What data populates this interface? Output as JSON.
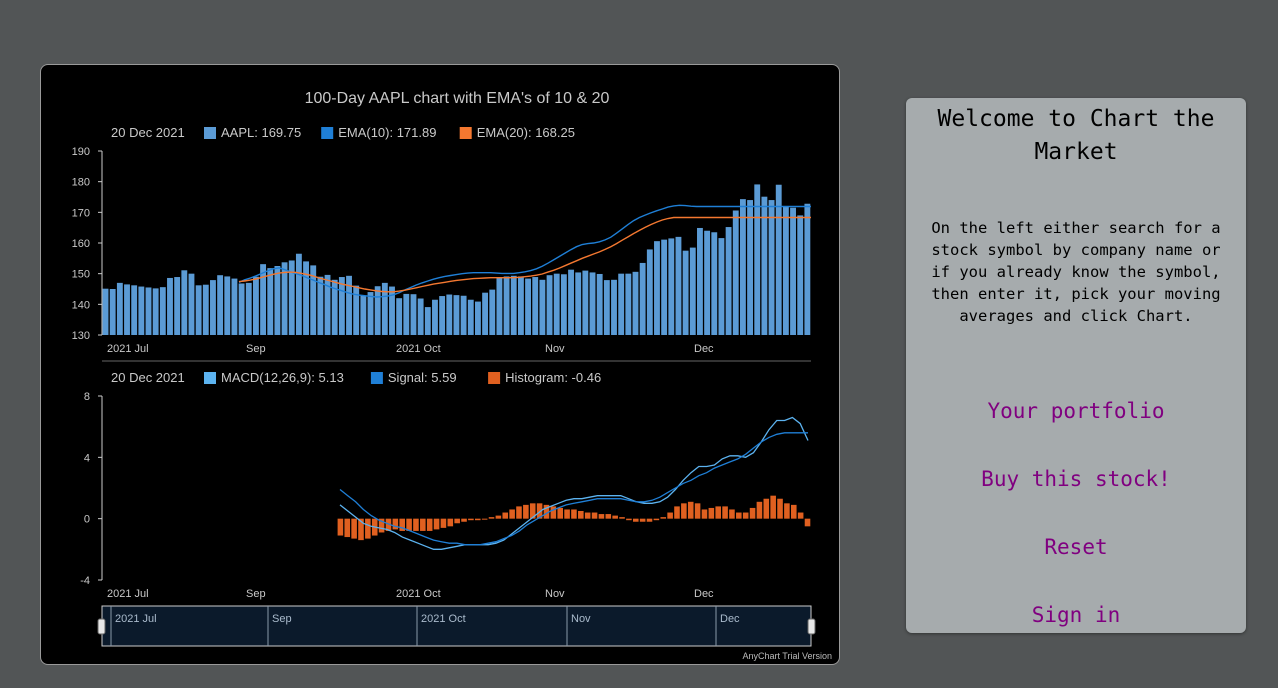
{
  "welcome": {
    "title": "Welcome to Chart the Market",
    "text": "On the left either search for a stock symbol by company name or if you already know the symbol, then enter it, pick your moving averages and click Chart.",
    "links": [
      "Your portfolio",
      "Buy this stock!",
      "Reset",
      "Sign in"
    ]
  },
  "chart_data": [
    {
      "type": "bar",
      "title": "100-Day AAPL chart with EMA's of 10 & 20",
      "legend": {
        "date": "20 Dec 2021",
        "items": [
          {
            "label": "AAPL: 169.75",
            "color": "#5b9bd5"
          },
          {
            "label": "EMA(10): 171.89",
            "color": "#1f7fd6"
          },
          {
            "label": "EMA(20): 168.25",
            "color": "#f47830"
          }
        ]
      },
      "ylim": [
        130,
        190
      ],
      "yticks": [
        "130",
        "140",
        "150",
        "160",
        "170",
        "180",
        "190"
      ],
      "xticks": [
        "2021 Jul",
        "Sep",
        "2021 Oct",
        "Nov",
        "Dec"
      ],
      "series": [
        {
          "name": "AAPL",
          "type": "bar",
          "color": "#5b9bd5",
          "values": [
            145.1,
            145.0,
            147.0,
            146.5,
            146.2,
            145.8,
            145.5,
            145.2,
            145.6,
            148.6,
            148.9,
            151.1,
            150.0,
            146.2,
            146.4,
            147.9,
            149.5,
            149.1,
            148.4,
            146.8,
            147.0,
            149.0,
            153.1,
            151.8,
            152.5,
            153.7,
            154.3,
            156.5,
            154.0,
            152.7,
            149.0,
            149.6,
            148.0,
            148.9,
            149.3,
            146.1,
            142.9,
            144.0,
            145.9,
            147.0,
            145.8,
            142.0,
            143.4,
            143.3,
            141.9,
            139.1,
            141.5,
            142.7,
            143.2,
            143.0,
            142.8,
            141.5,
            140.9,
            143.8,
            144.8,
            148.8,
            149.1,
            149.3,
            149.1,
            148.4,
            148.9,
            148.0,
            149.5,
            150.0,
            149.8,
            151.3,
            150.4,
            151.0,
            150.4,
            149.9,
            147.9,
            148.0,
            150.0,
            150.0,
            150.6,
            153.5,
            157.9,
            160.6,
            161.1,
            161.5,
            162.0,
            157.5,
            158.5,
            164.9,
            164.0,
            163.5,
            161.6,
            165.2,
            170.6,
            174.3,
            174.0,
            179.1,
            175.1,
            174.0,
            179.0,
            172.0,
            171.5,
            169.0,
            172.8
          ]
        },
        {
          "name": "EMA(10)",
          "type": "line",
          "color": "#1f7fd6",
          "x": [
            44,
            49,
            52,
            57,
            62,
            67,
            72,
            78,
            84,
            90,
            96,
            101,
            107,
            112,
            118,
            123,
            127,
            131,
            134,
            138,
            142,
            146,
            150,
            155,
            160,
            164,
            166,
            170,
            176,
            182,
            188,
            192,
            196,
            201,
            205,
            209,
            213,
            217,
            221,
            225,
            228,
            232,
            236,
            240,
            244,
            248,
            252,
            255,
            259,
            263,
            267,
            269,
            272,
            276,
            280,
            284,
            288,
            292,
            296,
            300,
            304,
            306,
            310,
            314,
            318,
            322,
            326,
            330,
            334,
            337,
            341,
            345,
            349,
            353,
            357,
            360,
            364,
            368,
            372,
            376,
            380,
            384,
            388,
            391,
            395,
            398,
            402,
            406,
            410,
            414,
            418,
            422,
            426,
            430,
            434,
            438,
            442,
            446,
            450,
            454,
            458
          ],
          "values": [
            147.2,
            148.0,
            148.6,
            149.3,
            150.1,
            150.9,
            151.6,
            151.9,
            151.3,
            150.6,
            150.0,
            149.4,
            148.6,
            147.9,
            147.1,
            146.4,
            145.6,
            145.0,
            144.4,
            143.8,
            143.3,
            143.0,
            142.8,
            142.6,
            142.4,
            142.5,
            142.7,
            143.1,
            143.8,
            144.7,
            145.5,
            146.3,
            147.0,
            147.6,
            148.2,
            148.7,
            149.1,
            149.4,
            149.7,
            150.0,
            150.2,
            150.3,
            150.3,
            150.3,
            150.3,
            150.2,
            150.1,
            150.1,
            150.1,
            150.3,
            150.6,
            151.0,
            151.6,
            152.4,
            153.4,
            154.5,
            155.6,
            156.7,
            157.8,
            158.8,
            159.5,
            159.8,
            160.0,
            160.4,
            161.0,
            161.9,
            163.2,
            164.6,
            166.0,
            167.3,
            168.3,
            169.1,
            169.8,
            170.5,
            171.1,
            171.7,
            172.1,
            172.3,
            172.2,
            172.0,
            171.9,
            171.9,
            171.9,
            171.9,
            171.9,
            171.9,
            171.9,
            171.9,
            171.9,
            171.9,
            171.9,
            171.9,
            171.9,
            171.9,
            171.9,
            171.9,
            171.9,
            171.9,
            171.9,
            171.9,
            171.9
          ]
        },
        {
          "name": "EMA(20)",
          "type": "line",
          "color": "#f47830",
          "values": [
            147.4,
            147.6,
            147.9,
            148.3,
            148.8,
            149.3,
            149.8,
            150.2,
            150.4,
            150.5,
            150.4,
            150.1,
            149.7,
            149.2,
            148.6,
            148.1,
            147.6,
            147.1,
            146.6,
            146.2,
            145.8,
            145.4,
            145.0,
            144.7,
            144.4,
            144.2,
            144.1,
            144.1,
            144.3,
            144.6,
            145.0,
            145.4,
            145.8,
            146.2,
            146.6,
            146.9,
            147.2,
            147.5,
            147.8,
            148.0,
            148.2,
            148.4,
            148.5,
            148.6,
            148.7,
            148.7,
            148.7,
            148.7,
            148.7,
            148.8,
            149.0,
            149.2,
            149.5,
            149.9,
            150.5,
            151.1,
            151.8,
            152.6,
            153.4,
            154.2,
            155.0,
            155.7,
            156.4,
            157.1,
            157.9,
            158.8,
            159.8,
            160.9,
            162.0,
            163.1,
            164.1,
            165.1,
            166.0,
            166.8,
            167.5,
            168.0,
            168.3,
            168.3,
            168.3,
            168.3,
            168.3,
            168.3,
            168.3,
            168.3,
            168.3,
            168.3,
            168.3,
            168.3,
            168.3,
            168.3,
            168.3,
            168.3,
            168.3,
            168.3,
            168.3,
            168.3,
            168.3,
            168.3,
            168.3,
            168.3,
            168.3
          ]
        }
      ]
    },
    {
      "type": "line",
      "legend": {
        "date": "20 Dec 2021",
        "items": [
          {
            "label": "MACD(12,26,9): 5.13",
            "color": "#5cb3f0"
          },
          {
            "label": "Signal: 5.59",
            "color": "#1f7fd6"
          },
          {
            "label": "Histogram: -0.46",
            "color": "#e06020"
          }
        ]
      },
      "ylim": [
        -4,
        8
      ],
      "yticks": [
        "-4",
        "0",
        "4",
        "8"
      ],
      "xticks": [
        "2021 Jul",
        "Sep",
        "2021 Oct",
        "Nov",
        "Dec"
      ],
      "series": [
        {
          "name": "MACD(12,26,9)",
          "color": "#5cb3f0",
          "values": [
            0.9,
            0.5,
            0.1,
            -0.3,
            -0.5,
            -0.6,
            -0.7,
            -0.9,
            -1.2,
            -1.4,
            -1.6,
            -1.8,
            -2.0,
            -2.0,
            -1.9,
            -1.8,
            -1.7,
            -1.7,
            -1.7,
            -1.7,
            -1.6,
            -1.4,
            -1.0,
            -0.6,
            -0.2,
            0.2,
            0.6,
            0.8,
            1.0,
            1.2,
            1.3,
            1.3,
            1.4,
            1.5,
            1.5,
            1.5,
            1.5,
            1.3,
            1.1,
            1.0,
            1.0,
            1.1,
            1.4,
            1.9,
            2.5,
            3.0,
            3.4,
            3.4,
            3.5,
            3.9,
            4.1,
            4.1,
            4.0,
            4.3,
            5.0,
            5.8,
            6.4,
            6.4,
            6.6,
            6.2,
            5.1
          ]
        },
        {
          "name": "Signal",
          "color": "#1f7fd6",
          "values": [
            1.9,
            1.5,
            1.1,
            0.6,
            0.2,
            -0.1,
            -0.3,
            -0.5,
            -0.6,
            -0.8,
            -1.0,
            -1.2,
            -1.4,
            -1.5,
            -1.6,
            -1.6,
            -1.7,
            -1.7,
            -1.7,
            -1.6,
            -1.5,
            -1.3,
            -1.1,
            -0.8,
            -0.4,
            -0.1,
            0.2,
            0.5,
            0.7,
            0.9,
            1.0,
            1.1,
            1.2,
            1.3,
            1.3,
            1.3,
            1.3,
            1.2,
            1.1,
            1.1,
            1.2,
            1.4,
            1.7,
            2.0,
            2.3,
            2.5,
            2.8,
            3.0,
            3.3,
            3.5,
            3.7,
            3.9,
            4.2,
            4.6,
            5.0,
            5.3,
            5.5,
            5.6,
            5.6,
            5.6,
            5.6
          ]
        },
        {
          "name": "Histogram",
          "type": "bar",
          "color": "#e06020",
          "values": [
            -1.1,
            -1.2,
            -1.3,
            -1.4,
            -1.3,
            -1.1,
            -0.9,
            -0.8,
            -0.7,
            -0.8,
            -0.8,
            -0.8,
            -0.8,
            -0.8,
            -0.7,
            -0.6,
            -0.5,
            -0.3,
            -0.2,
            -0.1,
            -0.1,
            0.0,
            0.1,
            0.2,
            0.4,
            0.6,
            0.8,
            0.9,
            1.0,
            1.0,
            0.9,
            0.8,
            0.7,
            0.6,
            0.6,
            0.5,
            0.4,
            0.4,
            0.3,
            0.3,
            0.2,
            0.1,
            -0.1,
            -0.2,
            -0.2,
            -0.2,
            -0.1,
            0.1,
            0.4,
            0.8,
            1.0,
            1.1,
            1.0,
            0.6,
            0.7,
            0.8,
            0.8,
            0.6,
            0.4,
            0.4,
            0.7,
            1.1,
            1.3,
            1.5,
            1.3,
            1.0,
            0.9,
            0.4,
            -0.5
          ]
        }
      ]
    }
  ],
  "navigator": {
    "labels": [
      "2021 Jul",
      "Sep",
      "2021 Oct",
      "Nov",
      "Dec"
    ]
  },
  "credit": "AnyChart Trial Version"
}
